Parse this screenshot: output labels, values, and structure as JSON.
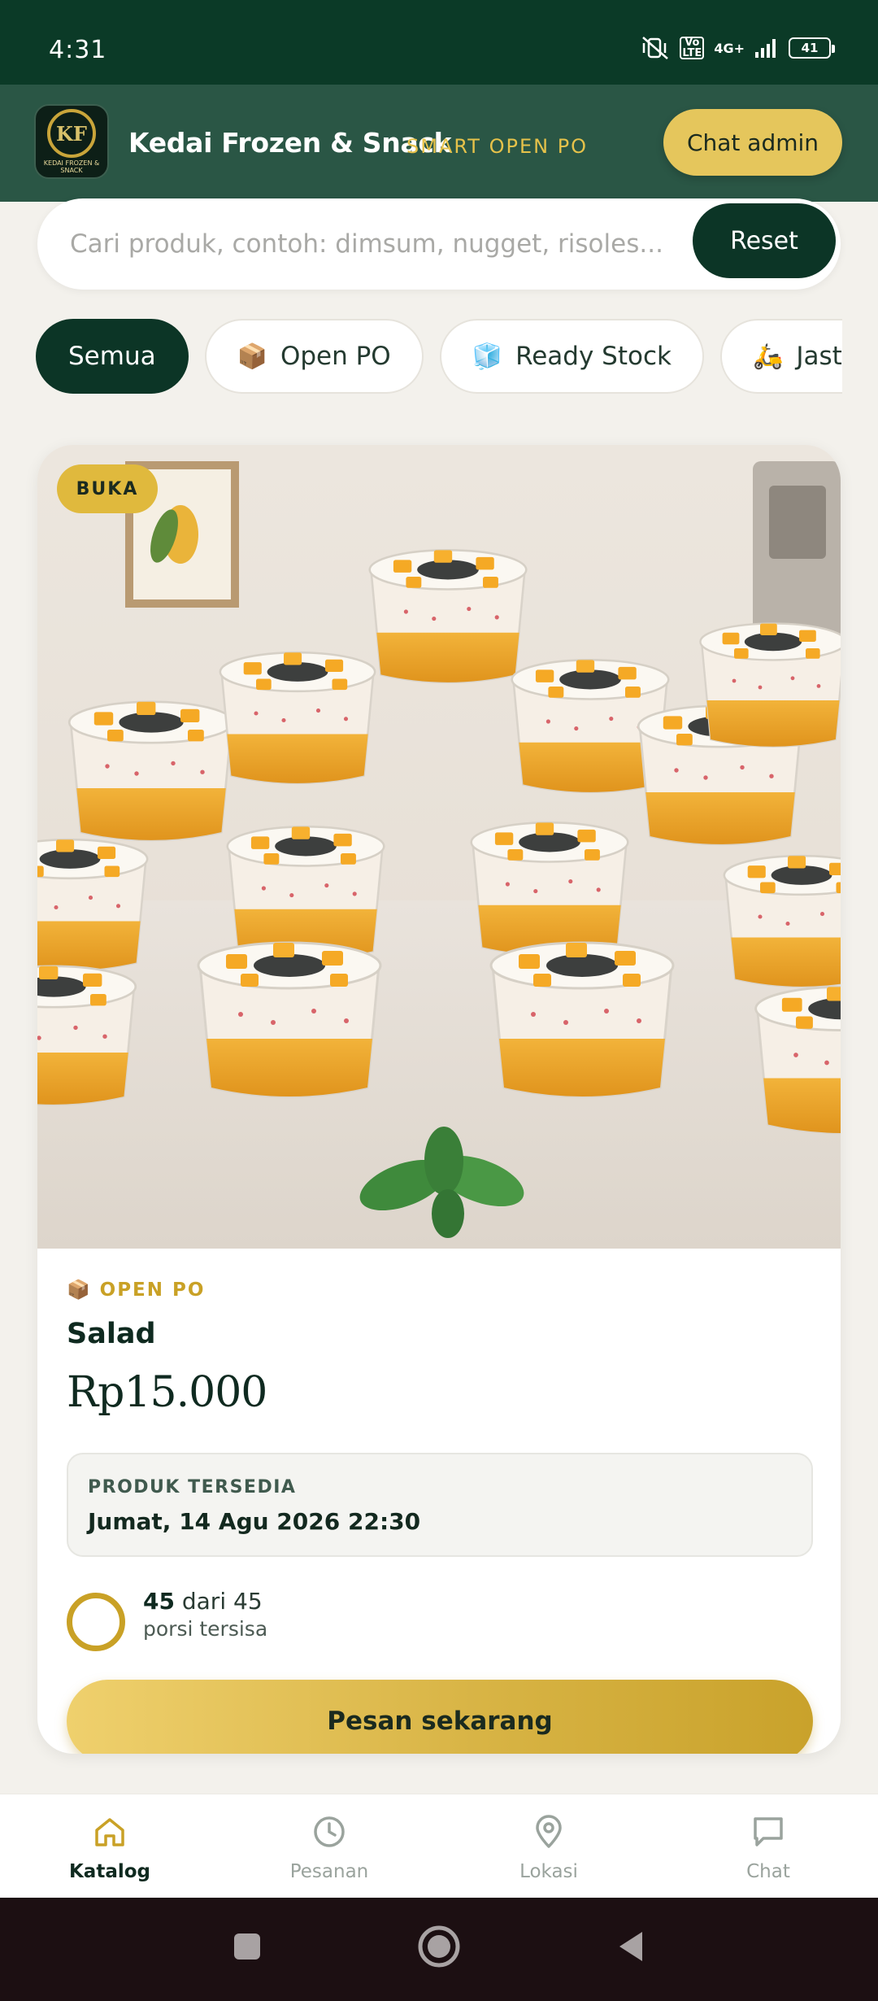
{
  "status_bar": {
    "time": "4:31",
    "network": "4G+",
    "volte": "Vo LTE",
    "battery": "41",
    "icons": [
      "mute-vibrate-icon",
      "volte-icon",
      "signal-icon",
      "battery-icon"
    ]
  },
  "header": {
    "logo_text": "KF",
    "logo_sub": "KEDAI FROZEN & SNACK",
    "brand_name": "Kedai Frozen & Snack",
    "tagline": "SMART OPEN PO",
    "chat_admin_label": "Chat admin"
  },
  "search": {
    "placeholder": "Cari produk, contoh: dimsum, nugget, risoles...",
    "value": "",
    "reset_label": "Reset"
  },
  "filters": [
    {
      "label": "Semua",
      "emoji": "",
      "active": true
    },
    {
      "label": "Open PO",
      "emoji": "📦",
      "active": false
    },
    {
      "label": "Ready Stock",
      "emoji": "🧊",
      "active": false
    },
    {
      "label": "Jastip",
      "emoji": "🛵",
      "active": false
    }
  ],
  "product": {
    "status_badge": "BUKA",
    "category_emoji": "📦",
    "category": "OPEN PO",
    "name": "Salad",
    "price": "Rp15.000",
    "availability_label": "PRODUK TERSEDIA",
    "availability_date": "Jumat, 14 Agu 2026 22:30",
    "stock_available": "45",
    "stock_total_text": "dari 45",
    "stock_unit": "porsi tersisa",
    "order_button": "Pesan sekarang"
  },
  "bottom_nav": [
    {
      "label": "Katalog",
      "icon": "home-icon",
      "active": true
    },
    {
      "label": "Pesanan",
      "icon": "clock-icon",
      "active": false
    },
    {
      "label": "Lokasi",
      "icon": "location-pin-icon",
      "active": false
    },
    {
      "label": "Chat",
      "icon": "chat-bubble-icon",
      "active": false
    }
  ],
  "colors": {
    "primary_dark": "#0c3526",
    "header_green": "#2a5645",
    "accent_gold": "#e0b93d",
    "background": "#f3f1ec"
  }
}
